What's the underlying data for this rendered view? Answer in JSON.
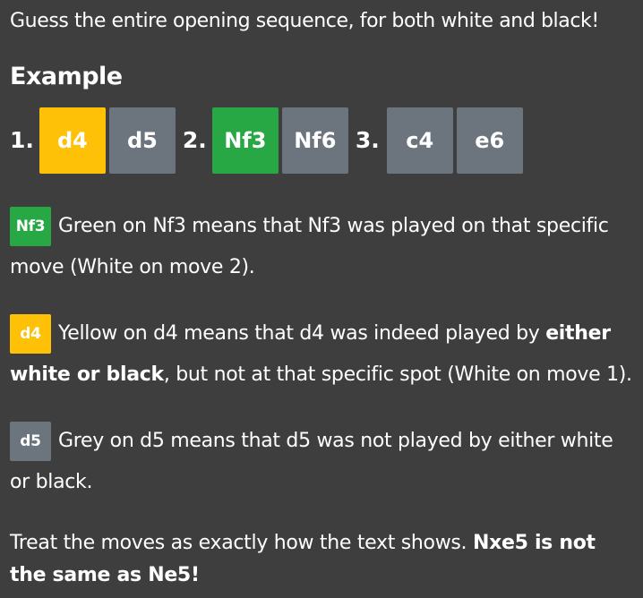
{
  "intro": "Guess the entire opening sequence, for both white and black!",
  "heading": "Example",
  "moves": [
    {
      "number": "1.",
      "white": {
        "text": "d4",
        "status": "yellow"
      },
      "black": {
        "text": "d5",
        "status": "grey"
      }
    },
    {
      "number": "2.",
      "white": {
        "text": "Nf3",
        "status": "green"
      },
      "black": {
        "text": "Nf6",
        "status": "grey"
      }
    },
    {
      "number": "3.",
      "white": {
        "text": "c4",
        "status": "grey"
      },
      "black": {
        "text": "e6",
        "status": "grey"
      }
    }
  ],
  "colors": {
    "background": "#3e3e3e",
    "green": "#28a745",
    "yellow": "#ffc107",
    "grey": "#6c757d",
    "text": "#ffffff"
  },
  "legend": {
    "green": {
      "badge": "Nf3",
      "text": "Green on Nf3 means that Nf3 was played on that specific move (White on move 2)."
    },
    "yellow": {
      "badge": "d4",
      "text_before": "Yellow on d4 means that d4 was indeed played by ",
      "text_bold": "either white or black",
      "text_after": ", but not at that specific spot (White on move 1)."
    },
    "grey": {
      "badge": "d5",
      "text": "Grey on d5 means that d5 was not played by either white or black."
    }
  },
  "footer": {
    "text": "Treat the moves as exactly how the text shows. ",
    "bold": "Nxe5 is not the same as Ne5!"
  }
}
